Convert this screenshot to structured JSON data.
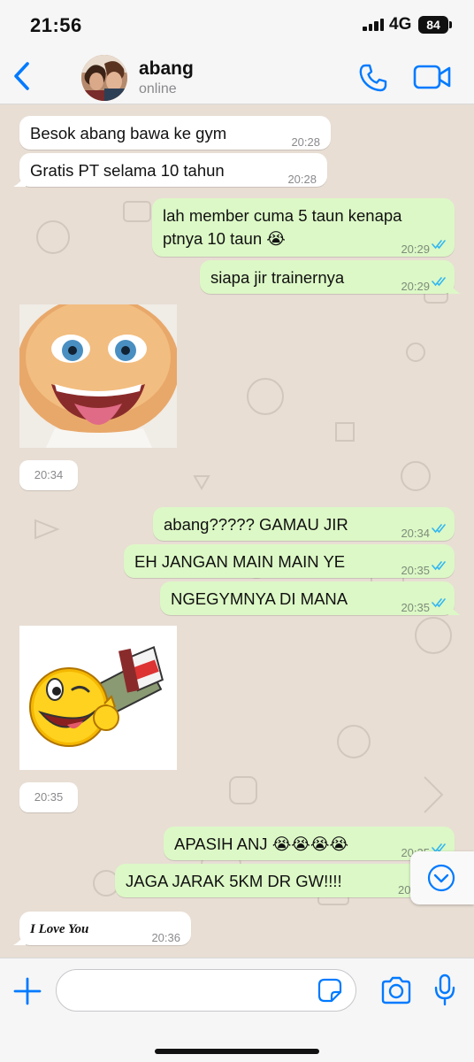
{
  "status_bar": {
    "time": "21:56",
    "network": "4G",
    "battery": "84"
  },
  "header": {
    "back_icon": "chevron-left-icon",
    "name": "abang",
    "status": "online",
    "call_icon": "phone-icon",
    "video_icon": "video-camera-icon"
  },
  "colors": {
    "accent": "#007aff",
    "outgoing_bubble": "#dcf8c6",
    "incoming_bubble": "#ffffff",
    "read_ticks": "#34b7f1",
    "wallpaper": "#e8ded4"
  },
  "messages": [
    {
      "direction": "in",
      "text": "Besok abang bawa ke gym",
      "time": "20:28"
    },
    {
      "direction": "in",
      "text": "Gratis PT selama 10 tahun",
      "time": "20:28"
    },
    {
      "direction": "out",
      "text": "lah member cuma 5 taun kenapa\nptnya 10 taun 😭",
      "time": "20:29",
      "status": "read"
    },
    {
      "direction": "out",
      "text": "siapa jir trainernya",
      "time": "20:29",
      "status": "read"
    },
    {
      "direction": "in",
      "type": "sticker",
      "sticker": "grinning-face-tongue-sticker",
      "time": "20:34"
    },
    {
      "direction": "out",
      "text": "abang????? GAMAU JIR",
      "time": "20:34",
      "status": "read"
    },
    {
      "direction": "out",
      "text": "EH JANGAN MAIN MAIN YE",
      "time": "20:35",
      "status": "read"
    },
    {
      "direction": "out",
      "text": "NGEGYMNYA DI MANA",
      "time": "20:35",
      "status": "read"
    },
    {
      "direction": "in",
      "type": "sticker",
      "sticker": "winking-emoji-thumbs-up-sticker",
      "time": "20:35"
    },
    {
      "direction": "out",
      "text": "APASIH ANJ 😭😭😭😭",
      "time": "20:35",
      "status": "read"
    },
    {
      "direction": "out",
      "text": "JAGA JARAK 5KM DR GW!!!!",
      "time": "20",
      "status": "read"
    },
    {
      "direction": "in",
      "text": "I Love You",
      "time": "20:36"
    }
  ],
  "input": {
    "placeholder": "",
    "value": ""
  },
  "icons": {
    "plus": "plus-icon",
    "sticker": "sticker-icon",
    "camera": "camera-icon",
    "mic": "microphone-icon",
    "scroll_down": "chevron-down-circle-icon"
  }
}
